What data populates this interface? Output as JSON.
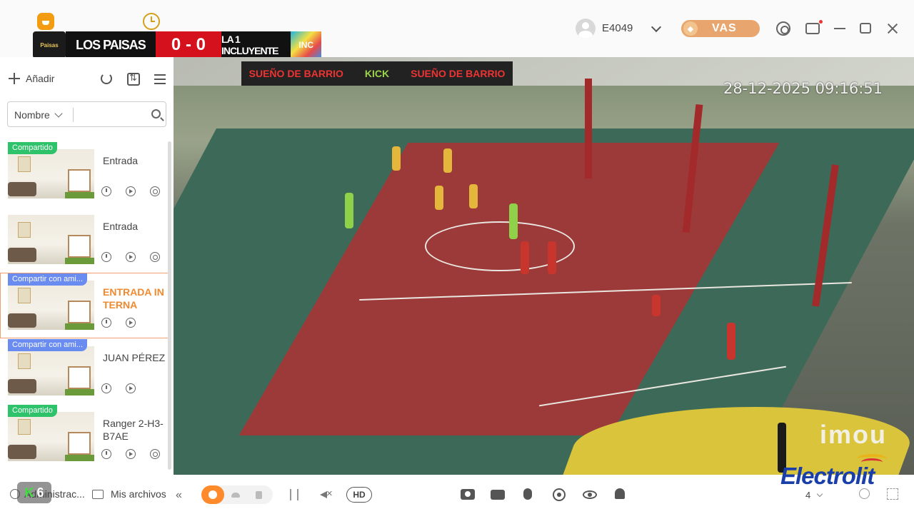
{
  "scoreboard": {
    "home_team": "LOS PAISAS",
    "score": "0 - 0",
    "away_team": "LA 1 INCLUYENTE",
    "home_logo_text": "Paisas",
    "away_logo_text": "INC"
  },
  "header": {
    "user_name": "E4049",
    "vip_label": "VAS"
  },
  "sidebar": {
    "add_label": "Añadir",
    "filter_label": "Nombre",
    "search_placeholder": "",
    "devices": [
      {
        "badge": "Compartido",
        "badge_color": "#2ec26a",
        "name": "Entrada",
        "selected": false
      },
      {
        "badge": "",
        "badge_color": "",
        "name": "Entrada",
        "selected": false
      },
      {
        "badge": "Compartir con ami...",
        "badge_color": "#6a8cf0",
        "name": "ENTRADA INTERNA",
        "selected": true
      },
      {
        "badge": "Compartir con ami...",
        "badge_color": "#6a8cf0",
        "name": "JUAN PÉREZ",
        "selected": false
      },
      {
        "badge": "Compartido",
        "badge_color": "#2ec26a",
        "name": "Ranger 2-H3-B7AE",
        "selected": false
      }
    ]
  },
  "video": {
    "timestamp": "28-12-2025 09:16:51",
    "watermark": "imou",
    "banner_left": "SUEÑO DE BARRIO",
    "banner_mid": "KICK",
    "banner_right": "SUEÑO DE BARRIO"
  },
  "bottombar": {
    "admin_label": "Administrac...",
    "overlay_badge_k": "K",
    "overlay_badge_num": "6",
    "files_label": "Mis archivos",
    "hd_label": "HD",
    "grid_value": "4",
    "brand_logo": "Electrolit"
  },
  "colors": {
    "accent": "#ff8a2c",
    "selected_text": "#f08a30",
    "shared_green": "#2ec26a",
    "shared_blue": "#6a8cf0",
    "score_red": "#d4111c"
  }
}
